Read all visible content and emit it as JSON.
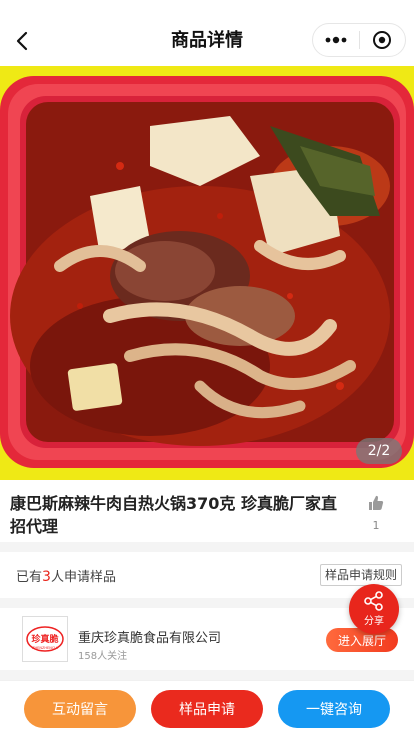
{
  "nav": {
    "title": "商品详情"
  },
  "hero": {
    "page_indicator": "2/2"
  },
  "product": {
    "title": "康巴斯麻辣牛肉自热火锅370克 珍真脆厂家直招代理",
    "like_count": "1"
  },
  "sample": {
    "prefix": "已有",
    "count": "3",
    "suffix": "人申请样品",
    "rules_label": "样品申请规则"
  },
  "company": {
    "name": "重庆珍真脆食品有限公司",
    "followers": "158人关注",
    "enter_label": "进入展厅",
    "logo_text": "珍真脆"
  },
  "share": {
    "label": "分享"
  },
  "bottom": {
    "message_label": "互动留言",
    "sample_label": "样品申请",
    "consult_label": "一键咨询"
  },
  "colors": {
    "accent_red": "#ea2a1e",
    "orange": "#f7953a",
    "blue": "#1598f2"
  }
}
